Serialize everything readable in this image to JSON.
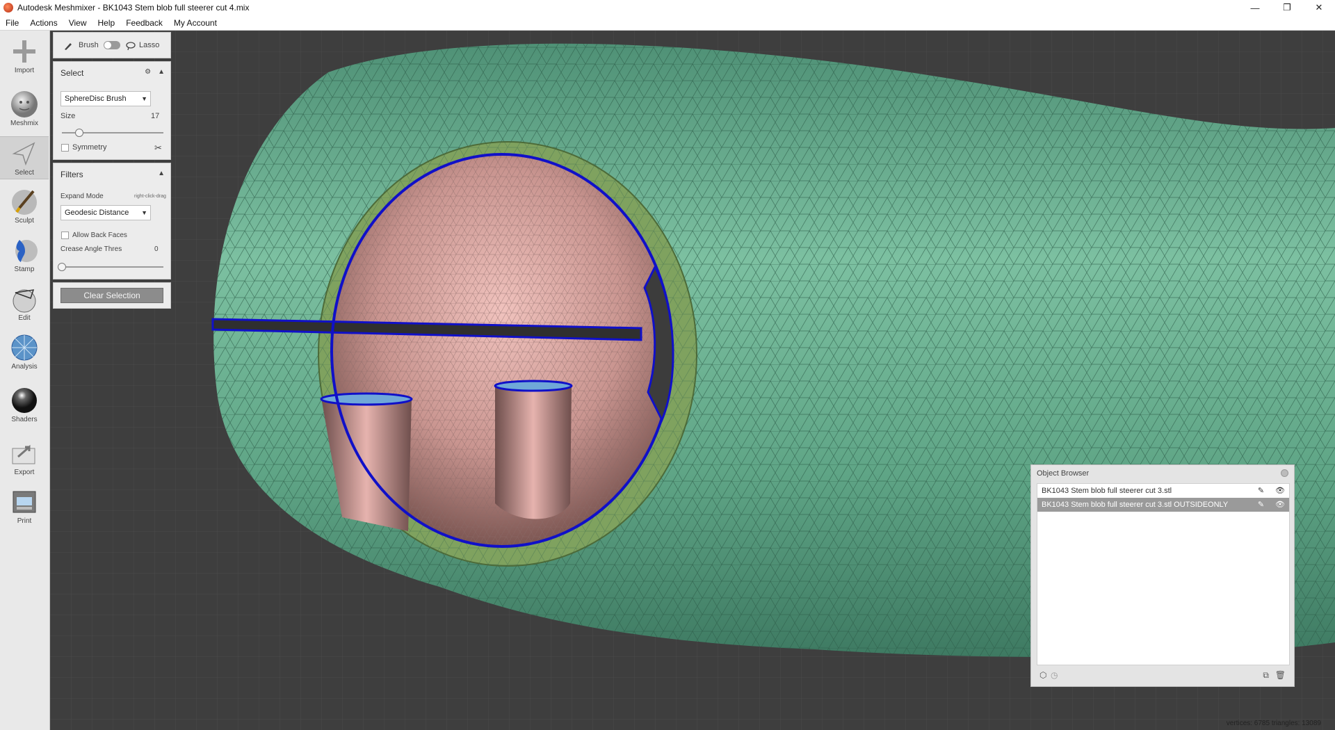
{
  "window": {
    "title": "Autodesk Meshmixer - BK1043 Stem blob full steerer cut 4.mix",
    "controls": {
      "minimize": "—",
      "maximize": "❐",
      "close": "✕"
    }
  },
  "menu": [
    "File",
    "Actions",
    "View",
    "Help",
    "Feedback",
    "My Account"
  ],
  "tools": [
    {
      "label": "Import",
      "icon": "plus-icon"
    },
    {
      "label": "Meshmix",
      "icon": "bunny-head-icon"
    },
    {
      "label": "Select",
      "icon": "select-arrow-icon",
      "active": true
    },
    {
      "label": "Sculpt",
      "icon": "sculpt-brush-icon"
    },
    {
      "label": "Stamp",
      "icon": "stamp-icon"
    },
    {
      "label": "Edit",
      "icon": "edit-sphere-icon"
    },
    {
      "label": "Analysis",
      "icon": "analysis-sphere-icon"
    },
    {
      "label": "Shaders",
      "icon": "shader-ball-icon"
    },
    {
      "label": "Export",
      "icon": "export-icon"
    },
    {
      "label": "Print",
      "icon": "printer-icon"
    }
  ],
  "mode_toggle": {
    "brush": "Brush",
    "lasso": "Lasso"
  },
  "select_panel": {
    "title": "Select",
    "brush_type": "SphereDisc Brush",
    "size_label": "Size",
    "size_value": "17",
    "size_fraction": 0.17,
    "symmetry_label": "Symmetry"
  },
  "filters_panel": {
    "title": "Filters",
    "expand_mode_label": "Expand Mode",
    "expand_mode_hint": "right-click-drag",
    "expand_mode_value": "Geodesic Distance",
    "allow_back_faces_label": "Allow Back Faces",
    "crease_label": "Crease Angle Thres",
    "crease_value": "0",
    "crease_fraction": 0.0
  },
  "clear_selection_label": "Clear Selection",
  "object_browser": {
    "title": "Object Browser",
    "items": [
      {
        "name": "BK1043 Stem blob full steerer cut 3.stl",
        "selected": false
      },
      {
        "name": "BK1043 Stem blob full steerer cut 3.stl OUTSIDEONLY",
        "selected": true
      }
    ]
  },
  "status": "vertices: 6785 triangles: 13089",
  "colors": {
    "mesh_green": "#5aa384",
    "interior_pink": "#d9a8a4",
    "cut_ring": "#7ea35e",
    "selection_outline": "#1010c8",
    "background": "#3d3d3d"
  }
}
